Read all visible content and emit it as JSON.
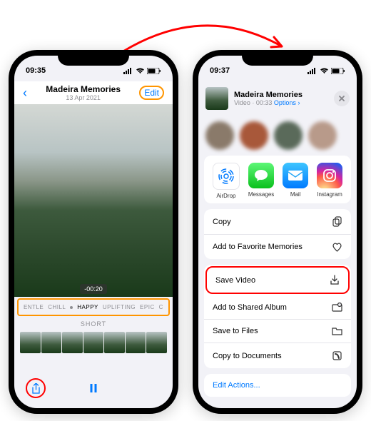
{
  "phone1": {
    "time": "09:35",
    "nav": {
      "title": "Madeira Memories",
      "subtitle": "13 Apr 2021",
      "edit": "Edit"
    },
    "playback_time": "-00:20",
    "moods": [
      "ENTLE",
      "CHILL",
      "HAPPY",
      "UPLIFTING",
      "EPIC",
      "C"
    ],
    "short_label": "SHORT"
  },
  "phone2": {
    "time": "09:37",
    "share": {
      "title": "Madeira Memories",
      "sub_prefix": "Video · 00:33",
      "options": "Options",
      "apps": {
        "airdrop": "AirDrop",
        "messages": "Messages",
        "mail": "Mail",
        "instagram": "Instagram"
      },
      "actions": {
        "copy": "Copy",
        "favorite": "Add to Favorite Memories",
        "save_video": "Save Video",
        "shared_album": "Add to Shared Album",
        "save_files": "Save to Files",
        "copy_docs": "Copy to Documents"
      },
      "edit_actions": "Edit Actions..."
    }
  }
}
